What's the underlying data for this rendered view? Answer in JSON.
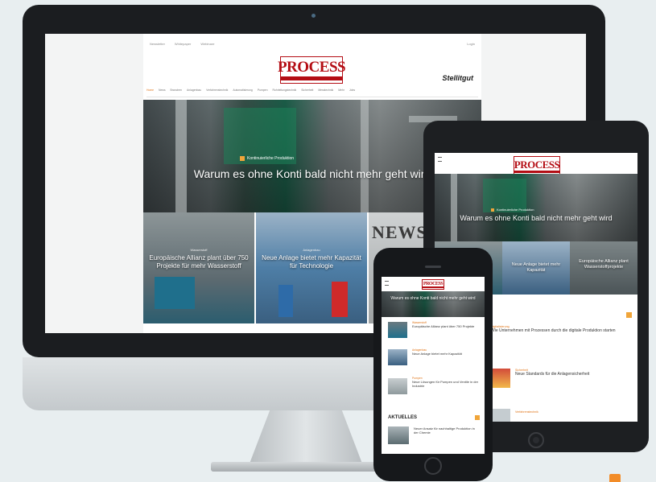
{
  "site": {
    "logo": "PROCESS",
    "partner_logo": "Stellitgut",
    "topnav": [
      "Newsletter",
      "Whitepaper",
      "Webinare"
    ],
    "topnav_right": "Login"
  },
  "desktop": {
    "nav": [
      "Home",
      "News",
      "Branchen",
      "Anlagenbau",
      "Verfahrenstechnik",
      "Automatisierung",
      "Pumpen",
      "Rohrleitungstechnik",
      "Sicherheit",
      "Messtechnik",
      "Mehr",
      "Jobs"
    ],
    "hero": {
      "kicker": "Kontinuierliche Produktion",
      "title": "Warum es ohne Konti bald nicht mehr geht wird"
    },
    "tiles": [
      {
        "kicker": "Wasserstoff",
        "title": "Europäische Allianz plant über 750 Projekte für mehr Wasserstoff"
      },
      {
        "kicker": "Anlagenbau",
        "title": "Neue Anlage bietet mehr Kapazität für Technologie"
      },
      {
        "kicker": "",
        "title": "NEWS"
      }
    ]
  },
  "tablet": {
    "logo": "PROCESS",
    "hero": {
      "kicker": "Kontinuierliche Produktion",
      "title": "Warum es ohne Konti bald nicht mehr geht wird"
    },
    "tiles": [
      {
        "title": "Neue Anlage bietet mehr Kapazität"
      },
      {
        "title": "Europäische Allianz plant Wasserstoffprojekte"
      }
    ],
    "list": [
      {
        "kicker": "Digitalisierung",
        "title": "Wie Unternehmen mit Prozessen durch die digitale Produktion starten"
      },
      {
        "kicker": "Sicherheit",
        "title": "Neue Standards für die Anlagensicherheit"
      },
      {
        "kicker": "Verfahrenstechnik",
        "title": ""
      }
    ]
  },
  "phone": {
    "logo": "PROCESS",
    "hero_title": "Warum es ohne Konti bald nicht mehr geht wird",
    "list": [
      {
        "kicker": "Wasserstoff",
        "title": "Europäische Allianz plant über 750 Projekte"
      },
      {
        "kicker": "Anlagenbau",
        "title": "Neue Anlage bietet mehr Kapazität"
      },
      {
        "kicker": "Pumpen",
        "title": "Neue Lösungen für Pumpen und Ventile in der Industrie"
      }
    ],
    "section_title": "AKTUELLES",
    "section_item": "Neuer Ansatz für nachhaltige Produktion in der Chemie"
  },
  "colors": {
    "brand_red": "#b40d14",
    "accent_orange": "#f0a53a",
    "device_dark": "#1b1d20"
  }
}
